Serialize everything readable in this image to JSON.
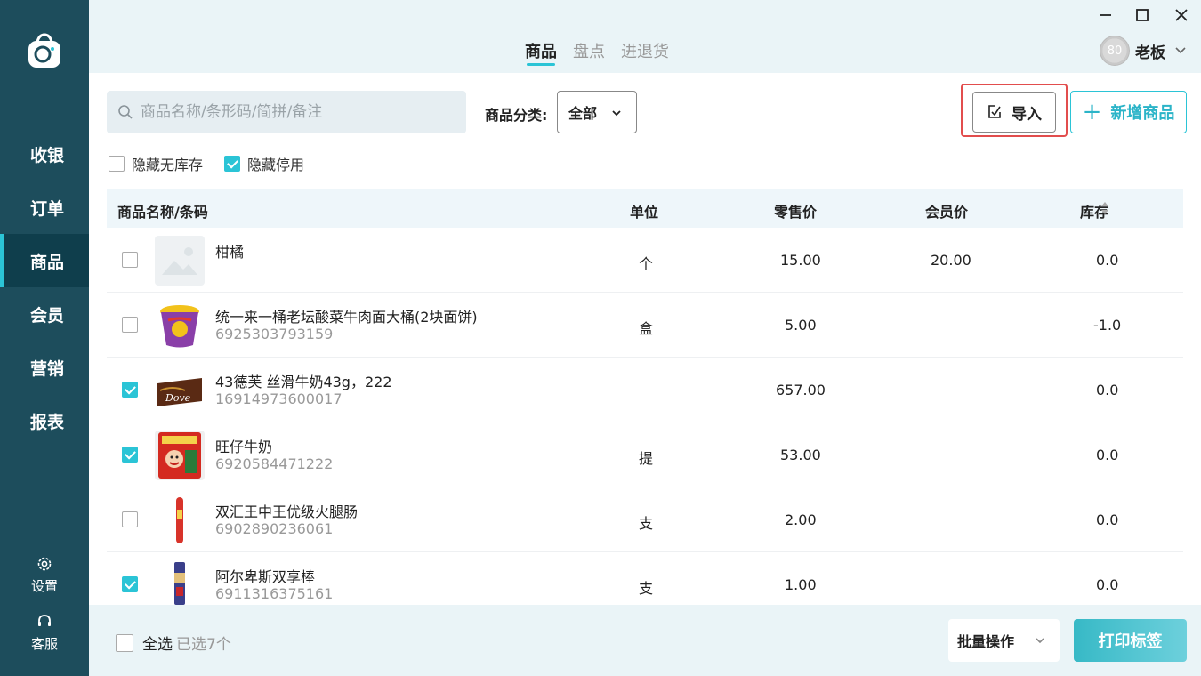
{
  "header": {
    "tabs": [
      {
        "label": "商品",
        "active": true
      },
      {
        "label": "盘点",
        "active": false
      },
      {
        "label": "进退货",
        "active": false
      }
    ],
    "user": {
      "avatar_text": "80",
      "name": "老板"
    }
  },
  "sidebar": {
    "items": [
      {
        "label": "收银"
      },
      {
        "label": "订单"
      },
      {
        "label": "商品",
        "active": true
      },
      {
        "label": "会员"
      },
      {
        "label": "营销"
      },
      {
        "label": "报表"
      }
    ],
    "settings_label": "设置",
    "support_label": "客服"
  },
  "toolbar": {
    "search_placeholder": "商品名称/条形码/简拼/备注",
    "category_label": "商品分类:",
    "category_value": "全部",
    "import_label": "导入",
    "add_label": "新增商品"
  },
  "filters": {
    "hide_no_stock": {
      "label": "隐藏无库存",
      "checked": false
    },
    "hide_disabled": {
      "label": "隐藏停用",
      "checked": true
    }
  },
  "table": {
    "columns": [
      "商品名称/条码",
      "单位",
      "零售价",
      "会员价",
      "库存"
    ],
    "rows": [
      {
        "checked": false,
        "name": "柑橘",
        "barcode": "",
        "unit": "个",
        "retail_price": "15.00",
        "member_price": "20.00",
        "stock": "0.0",
        "thumb": "placeholder"
      },
      {
        "checked": false,
        "name": "统一来一桶老坛酸菜牛肉面大桶(2块面饼)",
        "barcode": "6925303793159",
        "unit": "盒",
        "retail_price": "5.00",
        "member_price": "",
        "stock": "-1.0",
        "thumb": "noodle-cup"
      },
      {
        "checked": true,
        "name": "43德芙 丝滑牛奶43g，222",
        "barcode": "16914973600017",
        "unit": "",
        "retail_price": "657.00",
        "member_price": "",
        "stock": "0.0",
        "thumb": "chocolate"
      },
      {
        "checked": true,
        "name": "旺仔牛奶",
        "barcode": "6920584471222",
        "unit": "提",
        "retail_price": "53.00",
        "member_price": "",
        "stock": "0.0",
        "thumb": "milk-pack"
      },
      {
        "checked": false,
        "name": "双汇王中王优级火腿肠",
        "barcode": "6902890236061",
        "unit": "支",
        "retail_price": "2.00",
        "member_price": "",
        "stock": "0.0",
        "thumb": "sausage"
      },
      {
        "checked": true,
        "name": "阿尔卑斯双享棒",
        "barcode": "6911316375161",
        "unit": "支",
        "retail_price": "1.00",
        "member_price": "",
        "stock": "0.0",
        "thumb": "candy-stick"
      }
    ]
  },
  "footer": {
    "select_all_label": "全选",
    "selected_text": "已选7个",
    "batch_label": "批量操作",
    "print_label": "打印标签"
  },
  "colors": {
    "sidebar": "#1d4d5c",
    "accent": "#2bc4d6",
    "highlight": "#e24d4d"
  }
}
